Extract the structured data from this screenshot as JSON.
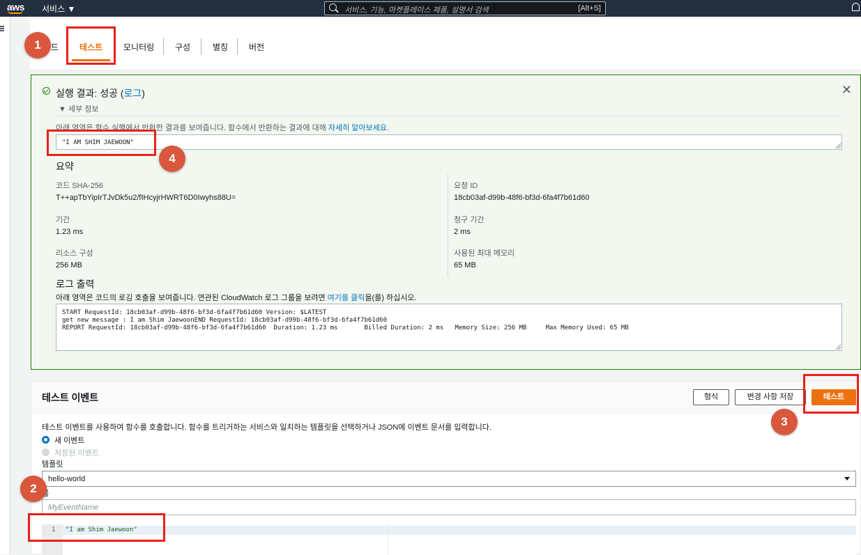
{
  "topbar": {
    "logo": "aws",
    "services_label": "서비스 ▼",
    "search_placeholder": "서비스, 기능, 마켓플레이스 제품, 설명서 검색",
    "search_shortcut": "[Alt+S]",
    "icons": [
      "search-icon",
      "bell-icon",
      "hamburger-icon"
    ]
  },
  "tabs": [
    {
      "label": "드"
    },
    {
      "label": "테스트",
      "active": true
    },
    {
      "label": "모니터링"
    },
    {
      "label": "구성"
    },
    {
      "label": "별칭"
    },
    {
      "label": "버전"
    }
  ],
  "result": {
    "title_prefix": "실행 결과: 성공 (",
    "title_link": "로그",
    "title_suffix": ")",
    "details_toggle": "▼  세부 정보",
    "description": "아래 영역은 함수 실행에서 반환한 결과를 보여줍니다. 함수에서 반환하는 결과에 대해 ",
    "description_link": "자세히 알아보세요",
    "description_end": ".",
    "output": "\"I AM SHIM JAEWOON\"",
    "summary_heading": "요약",
    "summary": {
      "code_sha_label": "코드 SHA-256",
      "code_sha_value": "T++apTbYipIrTJvDk5u2/fIHcyjrHWRT6D0Iwyhs88U=",
      "request_id_label": "요청 ID",
      "request_id_value": "18cb03af-d99b-48f6-bf3d-6fa4f7b61d60",
      "duration_label": "기간",
      "duration_value": "1.23 ms",
      "billed_label": "청구 기간",
      "billed_value": "2 ms",
      "resources_label": "리소스 구성",
      "resources_value": "256 MB",
      "max_mem_label": "사용된 최대 메모리",
      "max_mem_value": "65 MB"
    },
    "log_heading": "로그 출력",
    "log_description": "아래 영역은 코드의 로깅 호출을 보여줍니다. 연관된 CloudWatch 로그 그룹을 보려면 ",
    "log_link": "여기를 클릭",
    "log_description_end": "을(를) 하십시오.",
    "log_output": "START RequestId: 18cb03af-d99b-48f6-bf3d-6fa4f7b61d60 Version: $LATEST\nget new message : I am Shim JaewoonEND RequestId: 18cb03af-d99b-48f6-bf3d-6fa4f7b61d60\nREPORT RequestId: 18cb03af-d99b-48f6-bf3d-6fa4f7b61d60  Duration: 1.23 ms       Billed Duration: 2 ms   Memory Size: 256 MB     Max Memory Used: 65 MB"
  },
  "events": {
    "title": "테스트 이벤트",
    "format_button": "형식",
    "save_button": "변경 사항 저장",
    "test_button": "테스트",
    "description": "테스트 이벤트를 사용하여 함수를 호출합니다. 함수를 트리거하는 서비스와 일치하는 템플릿을 선택하거나 JSON에 이벤트 문서를 입력합니다.",
    "radio_new": "새 이벤트",
    "radio_saved": "저장된 이벤트",
    "template_label": "템플릿",
    "template_value": "hello-world",
    "name_label": "름",
    "name_placeholder": "MyEventName",
    "editor_line_number": "1",
    "editor_code": "\"I am Shim Jaewoon\""
  },
  "annotations": {
    "markers": [
      "1",
      "2",
      "3",
      "4"
    ],
    "highlight_color": "#e8201a",
    "marker_color": "#d9573d"
  },
  "colors": {
    "aws_orange": "#ec7211",
    "success_green": "#1d8102",
    "link_blue": "#0073bb",
    "topbar": "#232f3e"
  }
}
